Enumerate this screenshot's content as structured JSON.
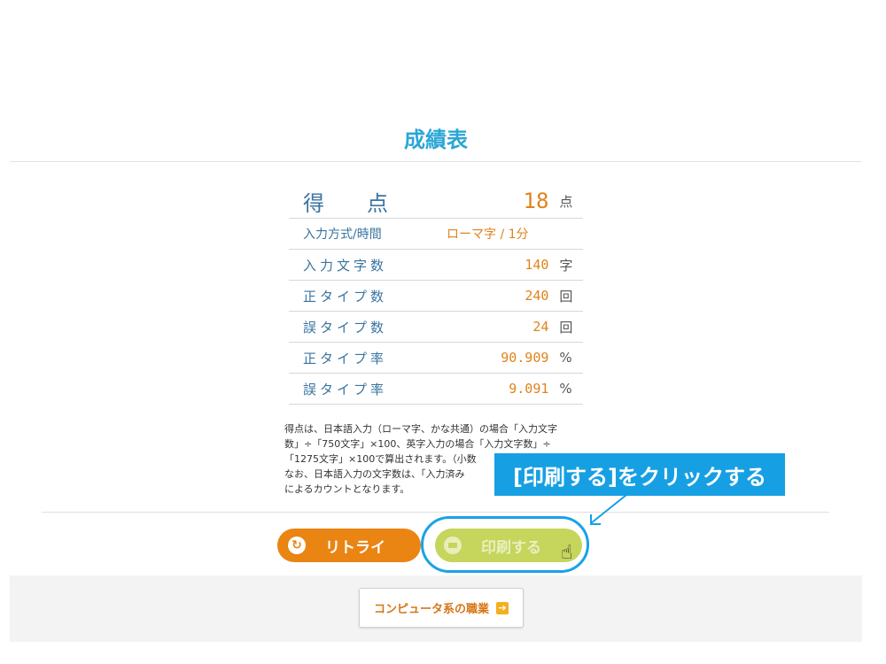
{
  "page_title": "成績表",
  "score": {
    "label": "得　　点",
    "value": "18",
    "unit": "点"
  },
  "rows": [
    {
      "label": "入力方式/時間",
      "value": "ローマ字 / 1分",
      "unit": ""
    },
    {
      "label": "入力文字数",
      "value": "140",
      "unit": "字"
    },
    {
      "label": "正タイプ数",
      "value": "240",
      "unit": "回"
    },
    {
      "label": "誤タイプ数",
      "value": "24",
      "unit": "回"
    },
    {
      "label": "正タイプ率",
      "value": "90.909",
      "unit": "%"
    },
    {
      "label": "誤タイプ率",
      "value": "9.091",
      "unit": "%"
    }
  ],
  "note": {
    "line1": "得点は、日本語入力（ローマ字、かな共通）の場合「入力文字",
    "line2": "数」÷「750文字」×100、英字入力の場合「入力文字数」÷",
    "line3": "「1275文字」×100で算出されます。（小数",
    "line4": "なお、日本語入力の文字数は、「入力済み",
    "line5": "によるカウントとなります。"
  },
  "buttons": {
    "retry": "リトライ",
    "print": "印刷する"
  },
  "callout": "[印刷する]をクリックする",
  "footer": {
    "career_button": "コンピュータ系の職業"
  },
  "colors": {
    "accent": "#2aa6d6",
    "value": "#e0821a",
    "retry": "#ea8413",
    "print": "#c6d55c",
    "callout": "#16a0e3"
  },
  "icons": {
    "retry": "retry-icon",
    "print": "printer-icon",
    "cursor": "hand-cursor-icon",
    "career": "arrow-right-icon"
  }
}
